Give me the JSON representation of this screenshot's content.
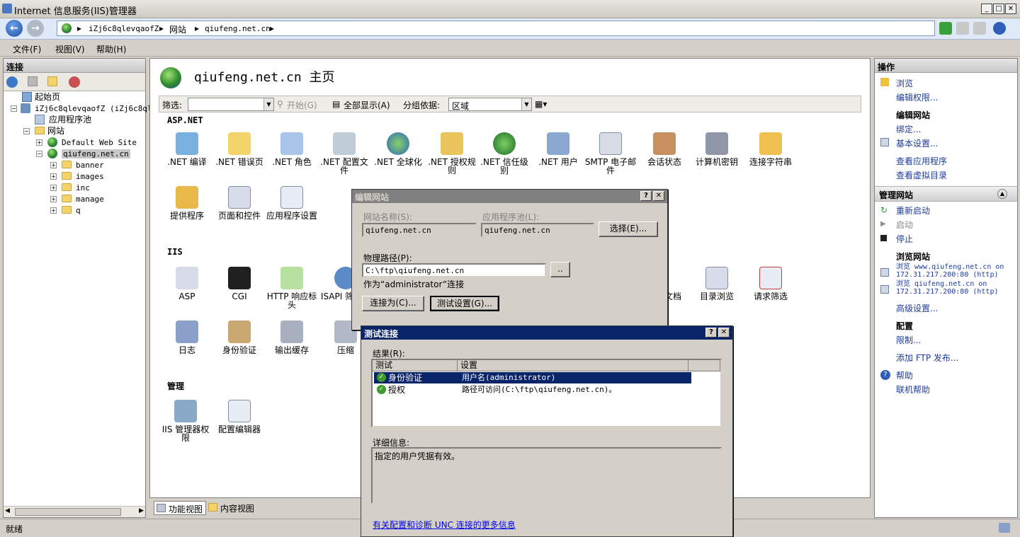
{
  "window": {
    "title": "Internet 信息服务(IIS)管理器"
  },
  "address": {
    "parts": [
      "iZj6c8qlevqaofZ",
      "网站",
      "qiufeng.net.cn"
    ]
  },
  "menu": {
    "file": "文件(F)",
    "view": "视图(V)",
    "help": "帮助(H)"
  },
  "connections": {
    "header": "连接",
    "tree": {
      "start": "起始页",
      "server": "iZj6c8qlevqaofZ (iZj6c8qle",
      "apppools": "应用程序池",
      "sites": "网站",
      "default_site": "Default Web Site",
      "site": "qiufeng.net.cn",
      "folders": [
        "banner",
        "images",
        "inc",
        "manage",
        "q"
      ]
    }
  },
  "main": {
    "title": "qiufeng.net.cn 主页",
    "filter": {
      "label": "筛选:",
      "start": "开始(G)",
      "show_all": "全部显示(A)",
      "group_label": "分组依据:",
      "group_value": "区域"
    },
    "sections": {
      "aspnet": "ASP.NET",
      "iis": "IIS",
      "manage": "管理"
    },
    "aspnet_features": [
      ".NET 编译",
      ".NET 错误页",
      ".NET 角色",
      ".NET 配置文件",
      ".NET 全球化",
      ".NET 授权规则",
      ".NET 信任级别",
      ".NET 用户",
      "SMTP 电子邮件",
      "会话状态",
      "计算机密钥",
      "连接字符串",
      "提供程序",
      "页面和控件",
      "应用程序设置"
    ],
    "iis_features": [
      "ASP",
      "CGI",
      "HTTP 响应标头",
      "ISAPI 筛选器",
      "日志",
      "身份验证",
      "输出缓存",
      "压缩",
      "文档",
      "目录浏览",
      "请求筛选"
    ],
    "manage_features": [
      "IIS 管理器权限",
      "配置编辑器"
    ],
    "view_features": "功能视图",
    "view_content": "内容视图"
  },
  "actions": {
    "header": "操作",
    "browse": "浏览",
    "edit_perms": "编辑权限...",
    "edit_site": "编辑网站",
    "bindings": "绑定...",
    "basic_settings": "基本设置...",
    "view_apps": "查看应用程序",
    "view_vdirs": "查看虚拟目录",
    "manage_site": "管理网站",
    "restart": "重新启动",
    "start": "启动",
    "stop": "停止",
    "browse_site": "浏览网站",
    "browse_www": "浏览 www.qiufeng.net.cn on 172.31.217.200:80 (http)",
    "browse_bare": "浏览 qiufeng.net.cn on 172.31.217.200:80 (http)",
    "advanced": "高级设置...",
    "config": "配置",
    "limits": "限制...",
    "add_ftp": "添加 FTP 发布...",
    "help": "帮助",
    "online_help": "联机帮助"
  },
  "status": {
    "text": "就绪"
  },
  "edit_dialog": {
    "title": "编辑网站",
    "site_name_label": "网站名称(S):",
    "site_name": "qiufeng.net.cn",
    "app_pool_label": "应用程序池(L):",
    "app_pool": "qiufeng.net.cn",
    "select_btn": "选择(E)...",
    "phys_label": "物理路径(P):",
    "phys_path": "C:\\ftp\\qiufeng.net.cn",
    "browse_btn": "..",
    "connect_as_text": "作为“administrator”连接",
    "connect_as_btn": "连接为(C)...",
    "test_btn": "测试设置(G)..."
  },
  "test_dialog": {
    "title": "测试连接",
    "results_label": "结果(R):",
    "col_test": "测试",
    "col_setting": "设置",
    "rows": [
      {
        "test": "身份验证",
        "setting": "用户名(administrator)"
      },
      {
        "test": "授权",
        "setting": "路径可访问(C:\\ftp\\qiufeng.net.cn)。"
      }
    ],
    "details_label": "详细信息:",
    "details": "指定的用户凭据有效。",
    "more_info": "有关配置和诊断 UNC 连接的更多信息"
  }
}
